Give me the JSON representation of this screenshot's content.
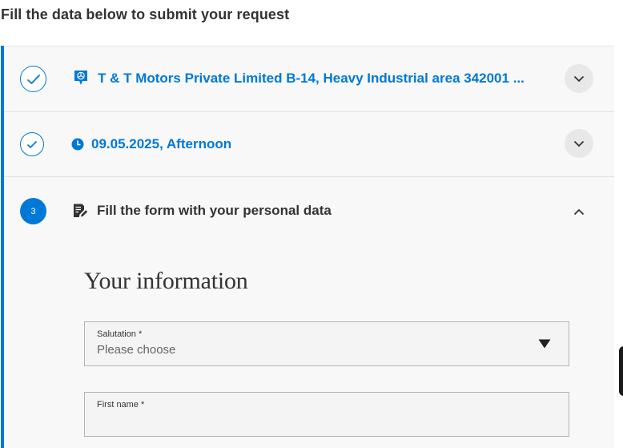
{
  "page": {
    "heading": "Fill the data below to submit your request"
  },
  "steps": [
    {
      "status": "completed",
      "icon": "dealer-location-icon",
      "title": "T & T Motors Private Limited B-14, Heavy Industrial area 342001 ..."
    },
    {
      "status": "completed",
      "icon": "clock-icon",
      "title": "09.05.2025, Afternoon"
    },
    {
      "status": "active",
      "number": "3",
      "icon": "form-edit-icon",
      "title": "Fill the form with your personal data"
    }
  ],
  "form": {
    "heading": "Your information",
    "salutation": {
      "label": "Salutation *",
      "value": "Please choose"
    },
    "first_name": {
      "label": "First name *",
      "value": ""
    }
  },
  "colors": {
    "accent": "#0078d6",
    "text": "#333333",
    "panel": "#f8f8f8"
  }
}
